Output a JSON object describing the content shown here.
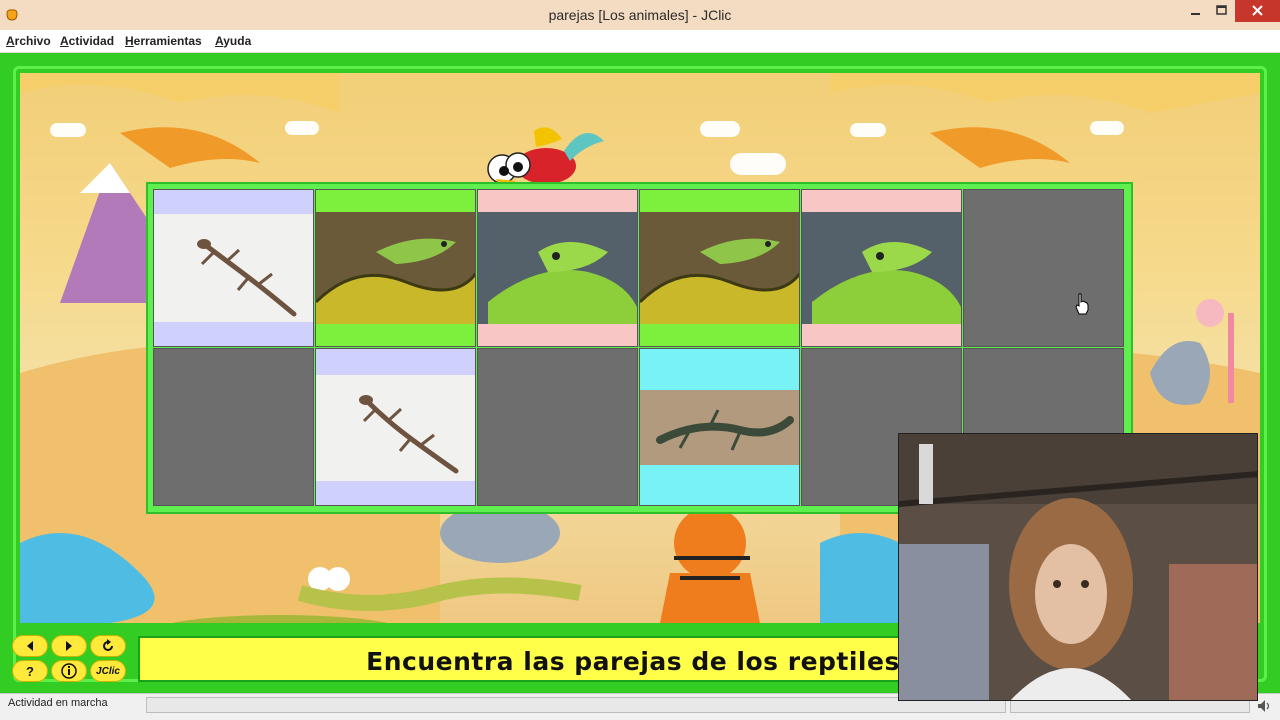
{
  "window": {
    "title": "parejas [Los animales] - JClic"
  },
  "menu": {
    "items": [
      "Archivo",
      "Actividad",
      "Herramientas",
      "Ayuda"
    ]
  },
  "board": {
    "rows": [
      [
        {
          "state": "shown",
          "color": "#cfd0fb",
          "image": "gecko"
        },
        {
          "state": "shown",
          "color": "#7df03e",
          "image": "green-snake"
        },
        {
          "state": "shown",
          "color": "#f9c6c6",
          "image": "iguana"
        },
        {
          "state": "shown",
          "color": "#7df03e",
          "image": "green-snake"
        },
        {
          "state": "shown",
          "color": "#f9c6c6",
          "image": "iguana"
        },
        {
          "state": "hidden",
          "color": "#6e6e6e",
          "image": ""
        }
      ],
      [
        {
          "state": "hidden",
          "color": "#6e6e6e",
          "image": ""
        },
        {
          "state": "shown",
          "color": "#cfd0fb",
          "image": "gecko"
        },
        {
          "state": "hidden",
          "color": "#6e6e6e",
          "image": ""
        },
        {
          "state": "shown",
          "color": "#78f2f4",
          "image": "wall-lizard"
        },
        {
          "state": "hidden",
          "color": "#6e6e6e",
          "image": ""
        },
        {
          "state": "hidden",
          "color": "#6e6e6e",
          "image": ""
        }
      ]
    ]
  },
  "controls": {
    "prev_icon": "arrow-left-icon",
    "next_icon": "arrow-right-icon",
    "restart_icon": "restart-icon",
    "help_label": "?",
    "info_icon": "info-icon",
    "logo_label": "JClic"
  },
  "message": {
    "text": "Encuentra las parejas de los reptiles"
  },
  "status": {
    "text": "Actividad en marcha"
  },
  "colors": {
    "frame_green": "#33cc22",
    "message_yellow": "#ffff4a",
    "button_yellow": "#ffe93a"
  }
}
